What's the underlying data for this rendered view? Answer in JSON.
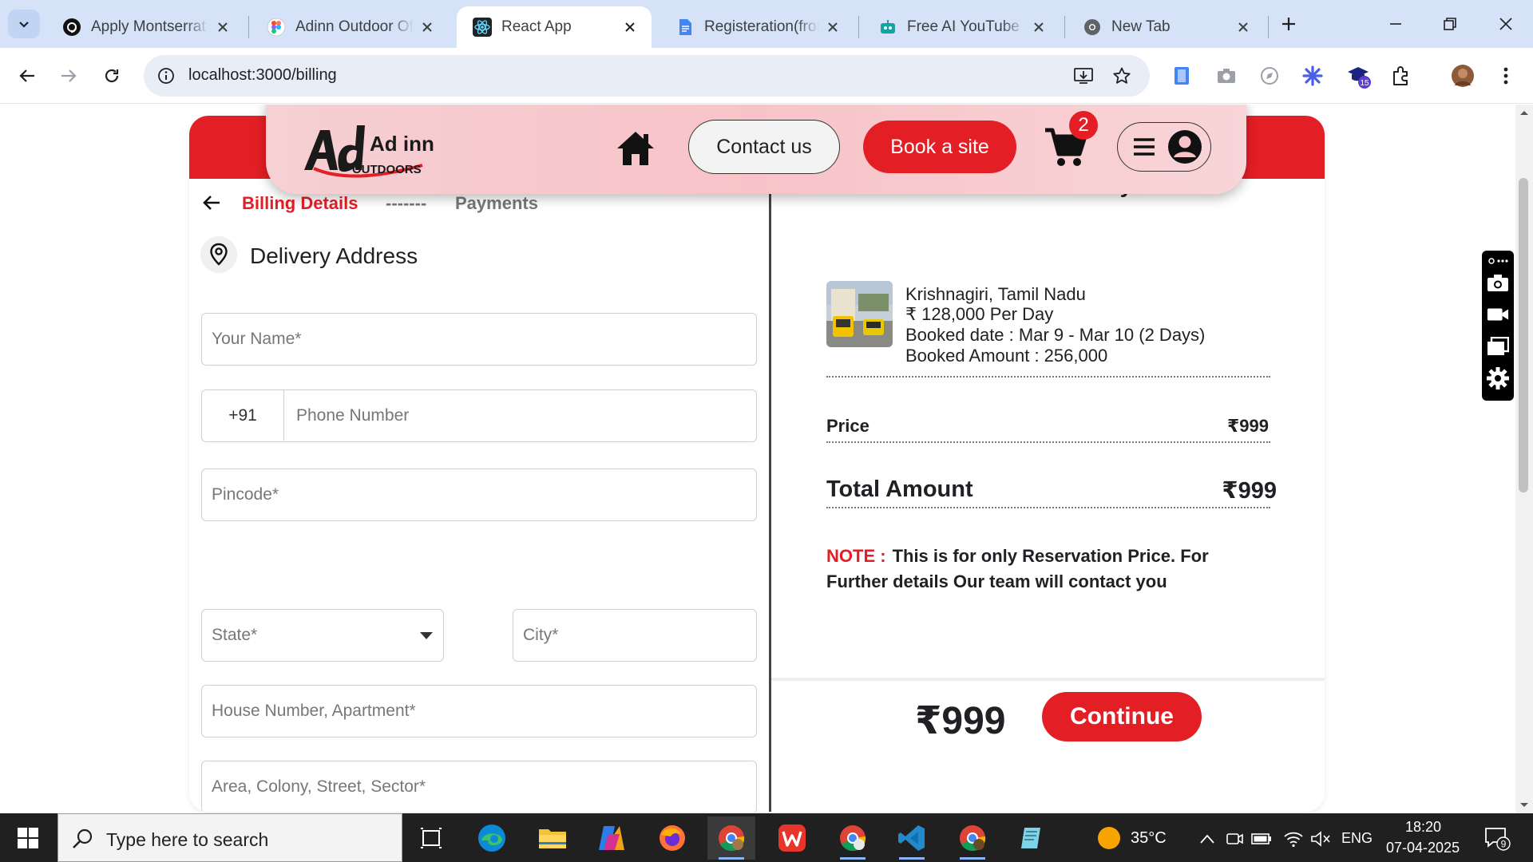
{
  "browser": {
    "tabs": [
      {
        "title": "Apply Montserrat F",
        "icon": "threads-icon",
        "active": false
      },
      {
        "title": "Adinn Outdoor Offi",
        "icon": "figma-icon",
        "active": false
      },
      {
        "title": "React App",
        "icon": "react-icon",
        "active": true
      },
      {
        "title": "Registeration(front",
        "icon": "google-docs-icon",
        "active": false
      },
      {
        "title": "Free AI YouTube Vi",
        "icon": "robot-icon",
        "active": false
      },
      {
        "title": "New Tab",
        "icon": "chrome-icon",
        "active": false
      }
    ],
    "url": "localhost:3000/billing",
    "extension_badge": "15"
  },
  "header": {
    "logo_text": "Ad inn",
    "logo_sub": "OUTDOORS",
    "contact_label": "Contact us",
    "book_label": "Book a site",
    "cart_count": "2"
  },
  "steps": {
    "active": "Billing Details",
    "separator": "-------",
    "next": "Payments"
  },
  "delivery": {
    "title": "Delivery Address",
    "name_placeholder": "Your Name*",
    "phone_code": "+91",
    "phone_placeholder": "Phone Number",
    "pincode_placeholder": "Pincode*",
    "state_placeholder": "State*",
    "city_placeholder": "City*",
    "house_placeholder": "House Number, Apartment*",
    "area_placeholder": "Area, Colony, Street, Sector*"
  },
  "summary": {
    "title": "Order Summary",
    "location": "Krishnagiri, Tamil Nadu",
    "rate": "₹ 128,000 Per Day",
    "booked_date": "Booked date : Mar 9 - Mar 10 (2 Days)",
    "booked_amount": "Booked Amount : 256,000",
    "price_label": "Price",
    "price_value": "₹999",
    "total_label": "Total Amount",
    "total_value": "₹999",
    "note_label": "NOTE :",
    "note_text": "This is for only Reservation Price. For Further details Our team will contact you"
  },
  "footer": {
    "amount": "₹999",
    "continue_label": "Continue"
  },
  "taskbar": {
    "search_placeholder": "Type here to search",
    "weather": "35°C",
    "language": "ENG",
    "time": "18:20",
    "date": "07-04-2025",
    "notification_count": "9"
  },
  "colors": {
    "brand_red": "#e31e25",
    "header_pink": "#f7c3c8",
    "tab_bar": "#d6e2f7"
  }
}
